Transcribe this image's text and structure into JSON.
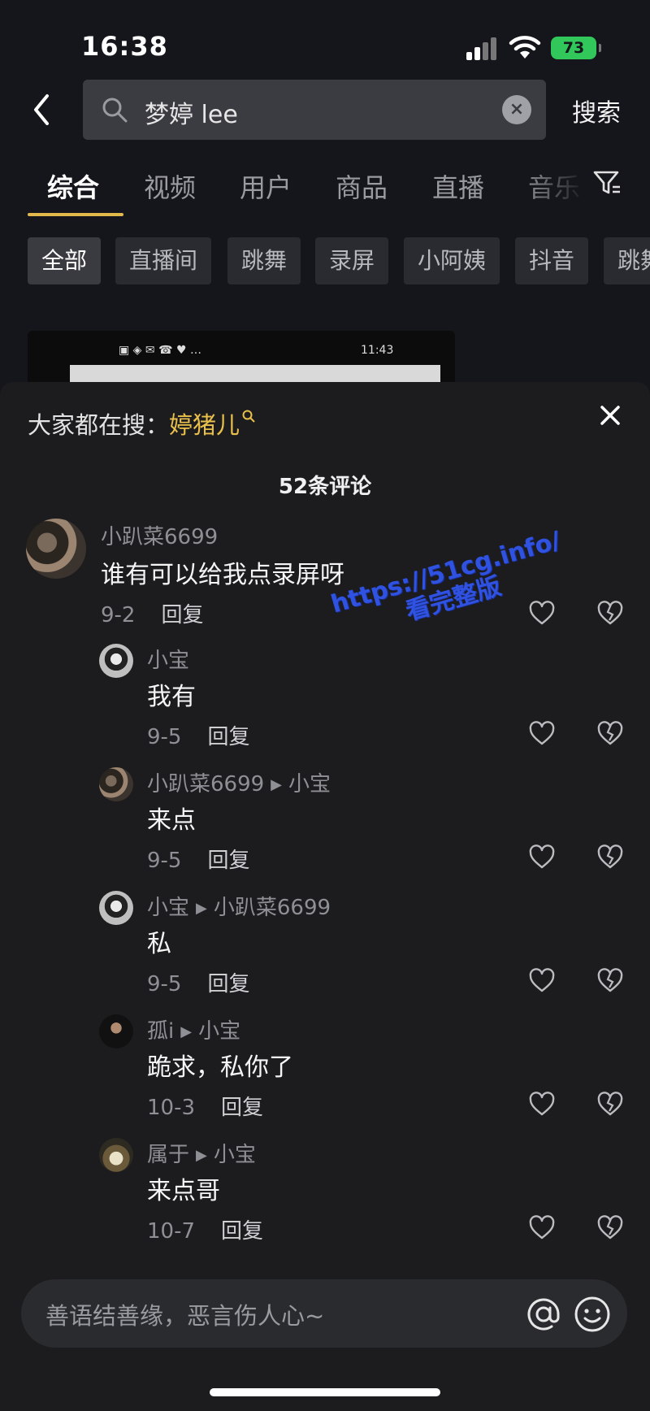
{
  "status_bar": {
    "time": "16:38",
    "battery": "73"
  },
  "search": {
    "query": "梦婷 lee",
    "button_label": "搜索"
  },
  "tabs": [
    "综合",
    "视频",
    "用户",
    "商品",
    "直播",
    "音乐"
  ],
  "chips": [
    "全部",
    "直播间",
    "跳舞",
    "录屏",
    "小阿姨",
    "抖音",
    "跳舞"
  ],
  "thumbnail": {
    "status_time": "11:43"
  },
  "comments_panel": {
    "hot_prefix": "大家都在搜：",
    "hot_keyword": "婷猪儿",
    "count_label": "52条评论",
    "comments": [
      {
        "user": "小趴菜6699",
        "text": "谁有可以给我点录屏呀",
        "date": "9-2",
        "reply_label": "回复"
      },
      {
        "user": "小宝",
        "reply_to": "",
        "text": "我有",
        "date": "9-5",
        "reply_label": "回复"
      },
      {
        "user": "小趴菜6699",
        "reply_to": "小宝",
        "text": "来点",
        "date": "9-5",
        "reply_label": "回复"
      },
      {
        "user": "小宝",
        "reply_to": "小趴菜6699",
        "text": "私",
        "date": "9-5",
        "reply_label": "回复"
      },
      {
        "user": "孤i",
        "reply_to": "小宝",
        "text": "跪求，私你了",
        "date": "10-3",
        "reply_label": "回复"
      },
      {
        "user": "属于",
        "reply_to": "小宝",
        "text": "来点哥",
        "date": "10-7",
        "reply_label": "回复"
      }
    ]
  },
  "watermark": {
    "line1": "https://51cg.info/",
    "line2": "看完整版"
  },
  "input": {
    "placeholder": "善语结善缘，恶言伤人心~"
  },
  "colors": {
    "accent": "#e1b84c",
    "keyword": "#e9c04c",
    "battery": "#31c75a",
    "watermark": "#2f52e0"
  }
}
